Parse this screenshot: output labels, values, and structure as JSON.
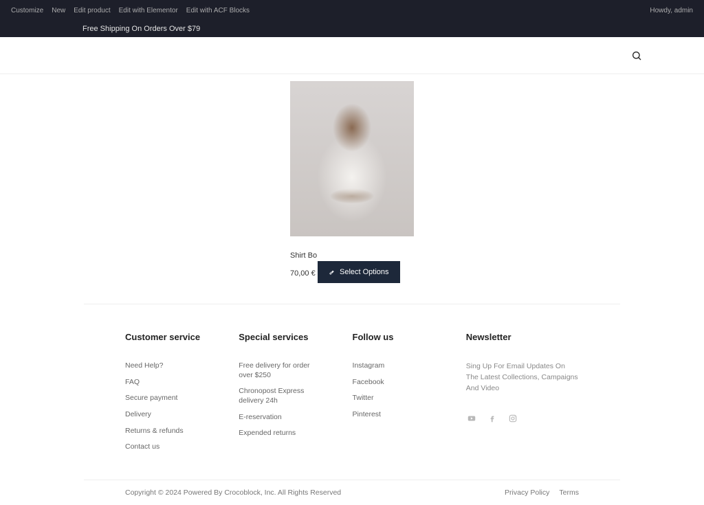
{
  "adminbar": {
    "items": [
      "Customize",
      "New",
      "Edit product",
      "Edit with Elementor",
      "Edit with ACF Blocks"
    ],
    "right": "Howdy, admin"
  },
  "announcement": "Free Shipping On Orders Over $79",
  "product": {
    "title": "Shirt Bo",
    "price": "70,00 €",
    "sale_price": "70,00 €",
    "button_label": "Select Options"
  },
  "footer": {
    "cols": [
      {
        "title": "Customer service",
        "items": [
          "Need Help?",
          "FAQ",
          "Secure payment",
          "Delivery",
          "Returns & refunds",
          "Contact us"
        ]
      },
      {
        "title": "Special services",
        "items": [
          "Free delivery for order over $250",
          "Chronopost Express delivery 24h",
          "E-reservation",
          "Expended returns"
        ]
      },
      {
        "title": "Follow us",
        "items": [
          "Instagram",
          "Facebook",
          "Twitter",
          "Pinterest"
        ]
      }
    ],
    "newsletter": {
      "title": "Newsletter",
      "text": "Sing Up For Email Updates On The Latest Collections, Campaigns And Video"
    }
  },
  "copyright": {
    "text": "Copyright © 2024 Powered By Crocoblock, Inc. All Rights Reserved",
    "privacy": "Privacy Policy",
    "terms": "Terms"
  }
}
